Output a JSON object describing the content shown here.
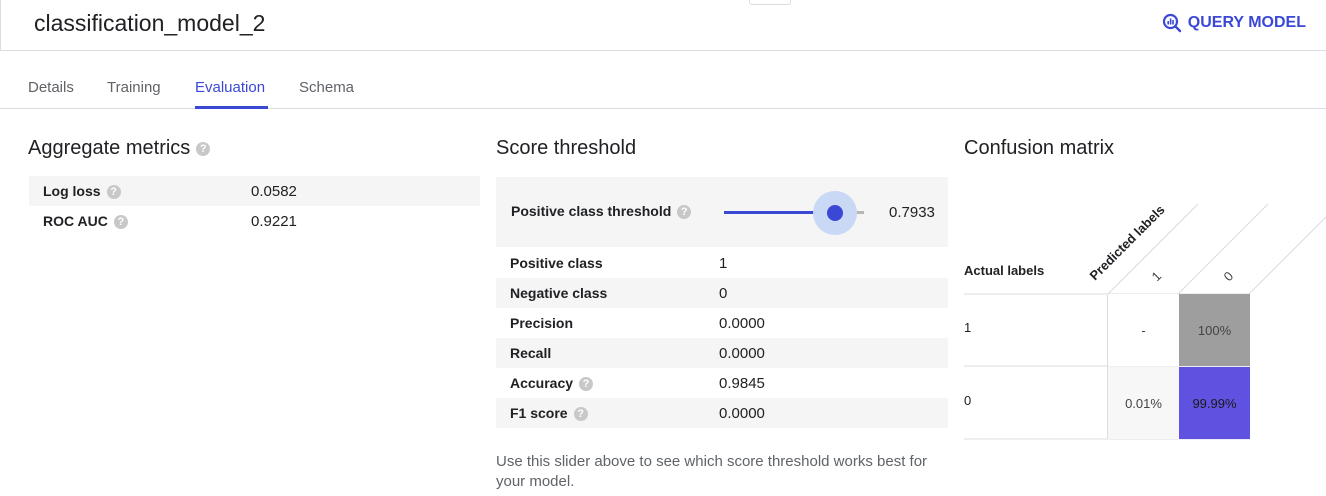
{
  "header": {
    "title": "classification_model_2",
    "query_label": "QUERY MODEL"
  },
  "tabs": [
    {
      "label": "Details"
    },
    {
      "label": "Training"
    },
    {
      "label": "Evaluation",
      "active": true
    },
    {
      "label": "Schema"
    }
  ],
  "aggregate": {
    "title": "Aggregate metrics",
    "rows": [
      {
        "label": "Log loss",
        "value": "0.0582"
      },
      {
        "label": "ROC AUC",
        "value": "0.9221"
      }
    ]
  },
  "threshold": {
    "title": "Score threshold",
    "label": "Positive class threshold",
    "value": "0.7933",
    "slider_fraction": 0.7933,
    "rows": [
      {
        "label": "Positive class",
        "value": "1"
      },
      {
        "label": "Negative class",
        "value": "0"
      },
      {
        "label": "Precision",
        "value": "0.0000"
      },
      {
        "label": "Recall",
        "value": "0.0000"
      },
      {
        "label": "Accuracy",
        "value": "0.9845"
      },
      {
        "label": "F1 score",
        "value": "0.0000"
      }
    ],
    "note": "Use this slider above to see which score threshold works best for your model."
  },
  "confusion": {
    "title": "Confusion matrix",
    "predicted_label": "Predicted labels",
    "actual_label": "Actual labels",
    "col_labels": [
      "1",
      "0"
    ],
    "row_labels": [
      "1",
      "0"
    ],
    "cells": [
      [
        "-",
        "100%"
      ],
      [
        "0.01%",
        "99.99%"
      ]
    ],
    "colors": {
      "gray": "#9e9e9e",
      "purple": "#6052e0",
      "light": "#f7f7f7"
    }
  },
  "colors": {
    "accent": "#3b48d6"
  }
}
